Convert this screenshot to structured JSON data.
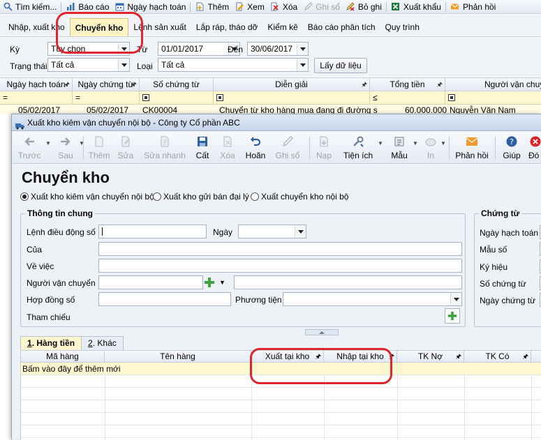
{
  "toolbar": {
    "items": [
      {
        "label": "Tìm kiếm...",
        "icon": "search-icon",
        "disabled": false
      },
      {
        "label": "Báo cáo",
        "icon": "report-icon",
        "disabled": false
      },
      {
        "label": "Ngày hạch toán",
        "icon": "calendar-icon",
        "disabled": false
      },
      {
        "label": "Thêm",
        "icon": "add-doc-icon",
        "disabled": false
      },
      {
        "label": "Xem",
        "icon": "view-icon",
        "disabled": false
      },
      {
        "label": "Xóa",
        "icon": "delete-icon",
        "disabled": false
      },
      {
        "label": "Ghi sổ",
        "icon": "post-icon",
        "disabled": true
      },
      {
        "label": "Bỏ ghi",
        "icon": "unpost-icon",
        "disabled": false
      },
      {
        "label": "Xuất khẩu",
        "icon": "excel-icon",
        "disabled": false
      },
      {
        "label": "Phản hồi",
        "icon": "mail-icon",
        "disabled": false
      }
    ]
  },
  "tabs": [
    "Nhập, xuất kho",
    "Chuyển kho",
    "Lệnh sản xuất",
    "Lắp ráp, tháo dỡ",
    "Kiểm kê",
    "Báo cáo phân tích",
    "Quy trình"
  ],
  "active_tab": "Chuyển kho",
  "filter": {
    "ky_label": "Kỳ",
    "ky_value": "Tùy chọn",
    "tu_label": "Từ",
    "tu_value": "01/01/2017",
    "den_label": "Đến",
    "den_value": "30/06/2017",
    "trang_thai_label": "Trạng thái",
    "trang_thai_value": "Tất cả",
    "loai_label": "Loại",
    "loai_value": "Tất cả",
    "load_button": "Lấy dữ liệu"
  },
  "grid": {
    "columns": [
      "Ngày hạch toán",
      "Ngày chứng từ",
      "Số chứng từ",
      "Diễn giải",
      "Tổng tiền",
      "Người vận chuyển"
    ],
    "filter_ops": [
      "=",
      "=",
      "",
      "",
      "≤",
      ""
    ],
    "row": {
      "ngay_hach_toan": "05/02/2017",
      "ngay_chung_tu": "05/02/2017",
      "so_chung_tu": "CK00004",
      "dien_giai": "Chuyển từ kho hàng mua đang đi đường s",
      "tong_tien": "60.000.000",
      "nguoi_van_chuyen": "Nguyễn Văn Nam"
    }
  },
  "dialog": {
    "title": "Xuất kho kiêm vận chuyển nội bộ - Công ty Cổ phần ABC",
    "toolbar": [
      {
        "label": "Trước",
        "icon": "arrow-left-icon",
        "disabled": true
      },
      {
        "label": "Sau",
        "icon": "arrow-right-icon",
        "disabled": true
      },
      {
        "label": "Thêm",
        "icon": "add-doc-icon",
        "disabled": true
      },
      {
        "label": "Sửa",
        "icon": "edit-icon",
        "disabled": true
      },
      {
        "label": "Sửa nhanh",
        "icon": "quick-edit-icon",
        "disabled": true
      },
      {
        "label": "Cất",
        "icon": "save-icon",
        "disabled": false
      },
      {
        "label": "Xóa",
        "icon": "delete-icon",
        "disabled": true
      },
      {
        "label": "Hoãn",
        "icon": "undo-icon",
        "disabled": false
      },
      {
        "label": "Ghi sổ",
        "icon": "post-icon",
        "disabled": true
      },
      {
        "label": "Nạp",
        "icon": "reload-icon",
        "disabled": true
      },
      {
        "label": "Tiện ích",
        "icon": "tools-icon",
        "disabled": false
      },
      {
        "label": "Mẫu",
        "icon": "template-icon",
        "disabled": false
      },
      {
        "label": "In",
        "icon": "print-icon",
        "disabled": true
      },
      {
        "label": "Phản hồi",
        "icon": "mail-icon",
        "disabled": false
      },
      {
        "label": "Giúp",
        "icon": "help-icon",
        "disabled": false
      },
      {
        "label": "Đó",
        "icon": "close-icon",
        "disabled": false
      }
    ],
    "heading": "Chuyển kho",
    "radios": [
      {
        "label": "Xuất kho kiêm vận chuyển nội bộ",
        "checked": true
      },
      {
        "label": "Xuất kho gửi bán đại lý",
        "checked": false
      },
      {
        "label": "Xuất chuyển kho nội bộ",
        "checked": false
      }
    ],
    "general_info": {
      "title": "Thông tin chung",
      "lenh_dieu_dong_label": "Lệnh điều động số",
      "ngay_label": "Ngày",
      "cua_label": "Của",
      "ve_viec_label": "Về việc",
      "nguoi_van_chuyen_label": "Người vận chuyển",
      "hop_dong_label": "Hợp đồng số",
      "phuong_tien_label": "Phương tiện",
      "tham_chieu_label": "Tham chiếu"
    },
    "voucher": {
      "title": "Chứng từ",
      "labels": [
        "Ngày hạch toán",
        "Mẫu số",
        "Ký hiệu",
        "Số chứng từ",
        "Ngày chứng từ"
      ]
    },
    "subtabs": [
      {
        "key": "1",
        "label": ". Hàng tiền"
      },
      {
        "key": "2",
        "label": ". Khác"
      }
    ],
    "detail_grid": {
      "columns": [
        "Mã hàng",
        "Tên hàng",
        "Xuất tại kho",
        "Nhập tại kho",
        "TK Nợ",
        "TK Có"
      ],
      "placeholder_row": "Bấm vào đây để thêm mới"
    }
  },
  "colors": {
    "highlight": "#e0262d",
    "active_tab": "#fff4c4",
    "filter_row": "#fff7cf"
  }
}
